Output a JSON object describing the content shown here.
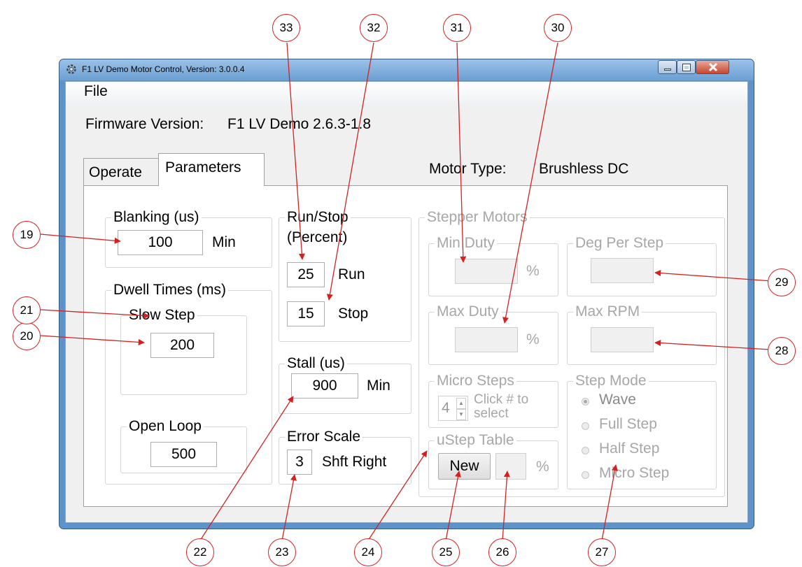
{
  "window": {
    "title": "F1 LV Demo Motor Control, Version: 3.0.0.4",
    "controls": [
      "minimize-icon",
      "maximize-icon",
      "close-icon"
    ]
  },
  "menu": {
    "file": "File"
  },
  "firmware": {
    "label": "Firmware Version:",
    "value": "F1 LV Demo 2.6.3-1.8"
  },
  "tabs": {
    "operate": "Operate",
    "parameters": "Parameters"
  },
  "motor_type": {
    "label": "Motor Type:",
    "value": "Brushless DC"
  },
  "blanking": {
    "title": "Blanking (us)",
    "value": "100",
    "unit": "Min"
  },
  "dwell": {
    "title": "Dwell Times (ms)",
    "slow_step": {
      "title": "Slow Step",
      "value": "200"
    },
    "open_loop": {
      "title": "Open Loop",
      "value": "500"
    }
  },
  "run_stop": {
    "title_line1": "Run/Stop",
    "title_line2": "(Percent)",
    "run_value": "25",
    "run_label": "Run",
    "stop_value": "15",
    "stop_label": "Stop"
  },
  "stall": {
    "title": "Stall (us)",
    "value": "900",
    "unit": "Min"
  },
  "error_scale": {
    "title": "Error Scale",
    "value": "3",
    "unit": "Shft Right"
  },
  "stepper": {
    "title": "Stepper Motors",
    "min_duty": {
      "title": "Min Duty",
      "value": "",
      "unit": "%"
    },
    "max_duty": {
      "title": "Max Duty",
      "value": "",
      "unit": "%"
    },
    "deg_per_step": {
      "title": "Deg Per Step",
      "value": ""
    },
    "max_rpm": {
      "title": "Max RPM",
      "value": ""
    },
    "micro_steps": {
      "title": "Micro Steps",
      "value": "4",
      "hint_line1": "Click # to",
      "hint_line2": "select"
    },
    "ustep_table": {
      "title": "uStep Table",
      "button": "New",
      "value": "",
      "unit": "%"
    },
    "step_mode": {
      "title": "Step Mode",
      "options": [
        "Wave",
        "Full Step",
        "Half Step",
        "Micro Step"
      ],
      "selected": "Wave"
    }
  },
  "callouts": [
    "33",
    "32",
    "31",
    "30",
    "19",
    "29",
    "20",
    "28",
    "21",
    "22",
    "23",
    "24",
    "25",
    "26",
    "27"
  ],
  "colors": {
    "callout_line": "#d62020",
    "window_frame": "#5e93c9"
  }
}
